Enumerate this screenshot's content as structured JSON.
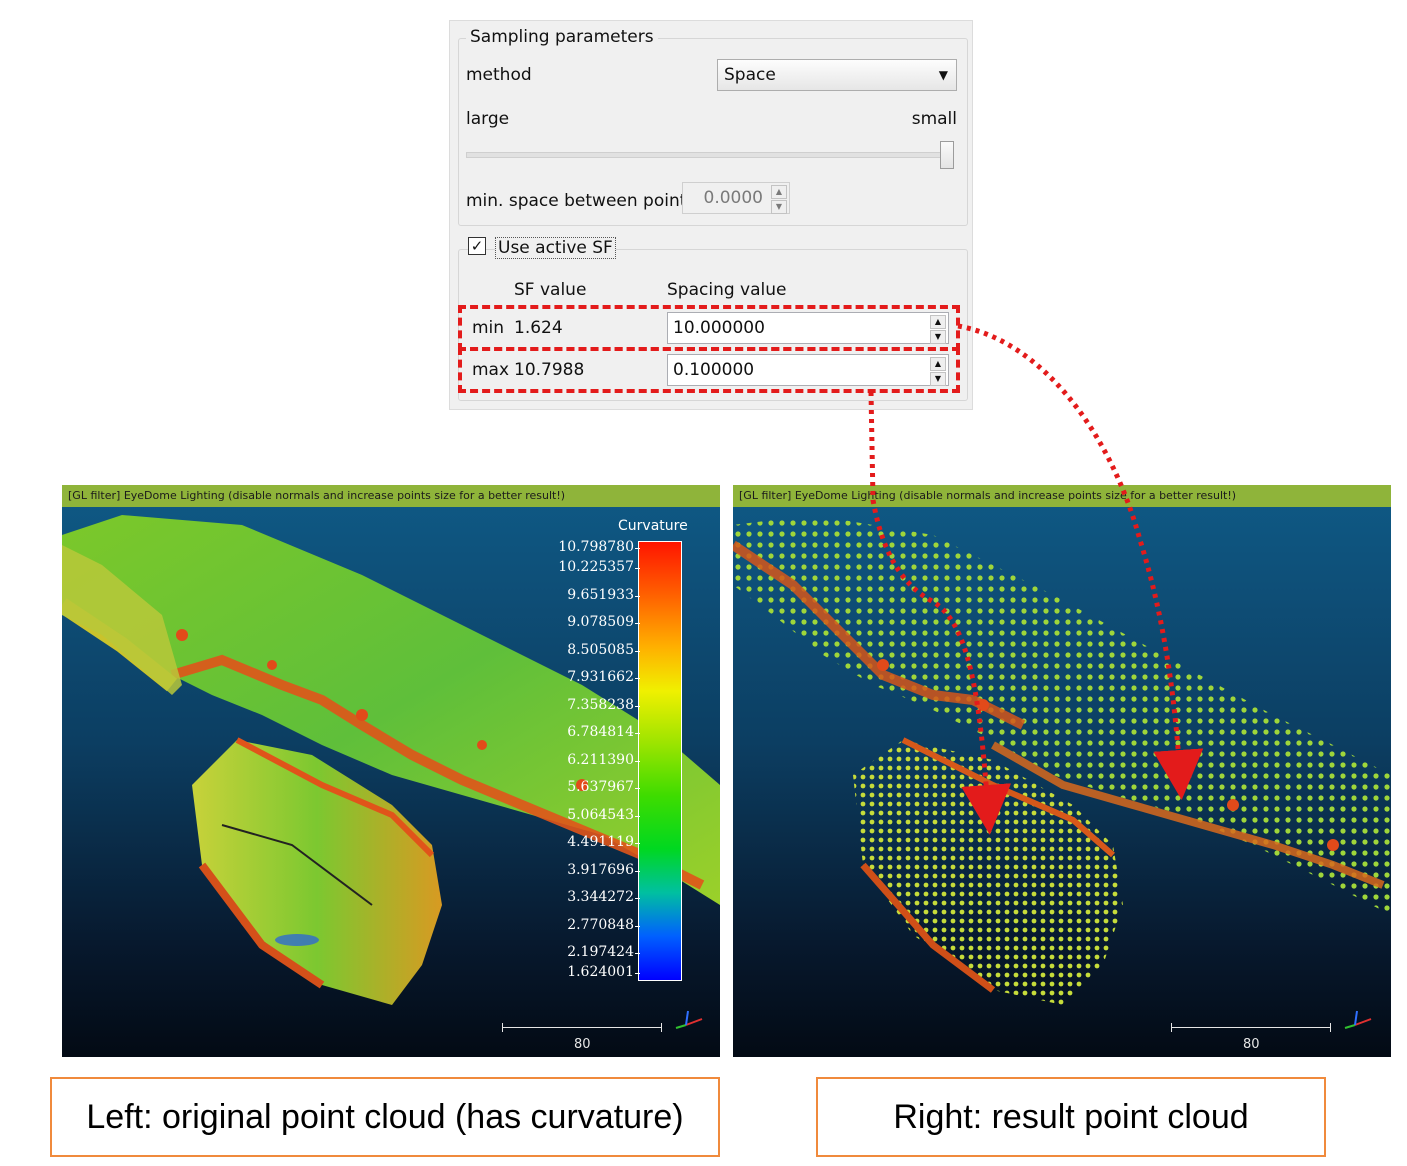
{
  "dialog": {
    "group_title": "Sampling parameters",
    "method_label": "method",
    "method_value": "Space",
    "slider_left_label": "large",
    "slider_right_label": "small",
    "slider_position": 0.97,
    "min_space_label": "min. space between points",
    "min_space_value": "0.0000",
    "use_active_sf_label": "Use active SF",
    "use_active_sf_checked": true,
    "sf_value_header": "SF value",
    "spacing_value_header": "Spacing value",
    "rows": [
      {
        "label": "min",
        "sf": "1.624",
        "spacing": "10.000000"
      },
      {
        "label": "max",
        "sf": "10.7988",
        "spacing": "0.100000"
      }
    ]
  },
  "viewports": {
    "banner_text": "[GL filter] EyeDome Lighting (disable normals and increase points size for a better result!)",
    "scale_value": "80",
    "colorbar": {
      "title": "Curvature",
      "ticks": [
        "10.798780",
        "10.225357",
        "9.651933",
        "9.078509",
        "8.505085",
        "7.931662",
        "7.358238",
        "6.784814",
        "6.211390",
        "5.637967",
        "5.064543",
        "4.491119",
        "3.917696",
        "3.344272",
        "2.770848",
        "2.197424",
        "1.624001"
      ]
    }
  },
  "captions": {
    "left": "Left: original point cloud (has curvature)",
    "right": "Right: result point cloud"
  },
  "colors": {
    "highlight": "#e31b1b",
    "caption_border": "#f08a3c",
    "banner": "#8fb43a"
  }
}
